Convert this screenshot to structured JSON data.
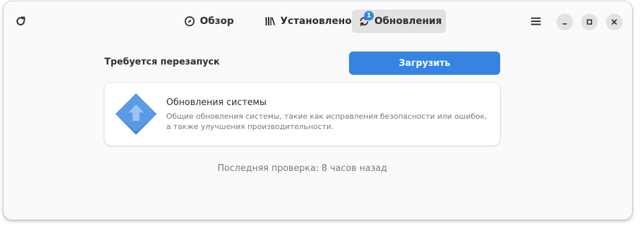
{
  "header": {
    "refresh_icon": "refresh-icon",
    "tabs": [
      {
        "label": "Обзор",
        "icon": "compass-icon"
      },
      {
        "label": "Установлено",
        "icon": "library-icon"
      },
      {
        "label": "Обновления",
        "icon": "update-icon",
        "badge": "1",
        "active": true
      }
    ],
    "menu_icon": "hamburger-icon"
  },
  "main": {
    "restart_label": "Требуется перезапуск",
    "download_label": "Загрузить",
    "update_card": {
      "title": "Обновления системы",
      "description": "Общие обновления системы, такие как исправления безопасности или ошибок, а также улучшения производительности.",
      "icon": "system-update-icon"
    },
    "last_check": "Последняя проверка: 8 часов назад"
  },
  "colors": {
    "accent": "#3584e4",
    "icon_blue": "#5b9be6"
  }
}
